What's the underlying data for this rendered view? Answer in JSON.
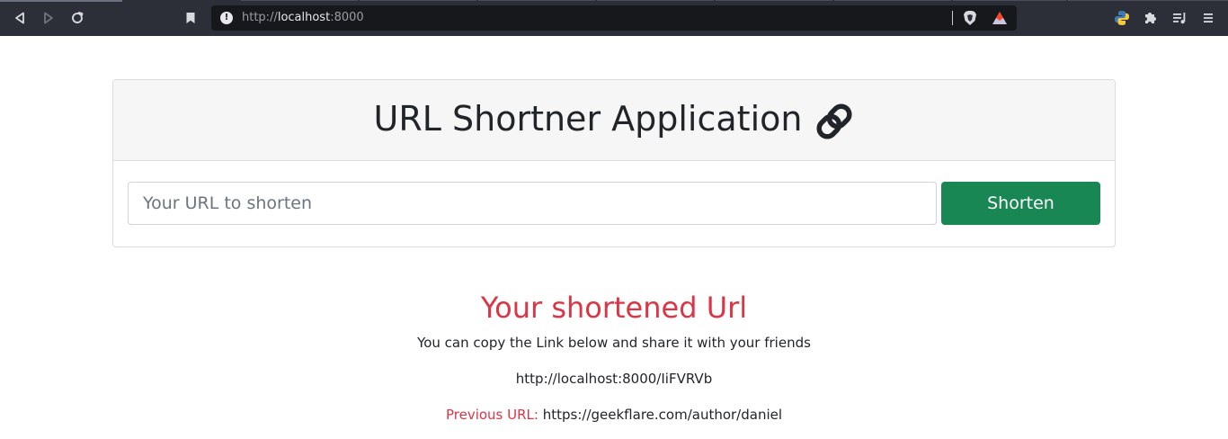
{
  "browser": {
    "address": {
      "scheme": "http://",
      "host": "localhost",
      "port": ":8000"
    }
  },
  "colors": {
    "accent_green": "#198754",
    "accent_red": "#dc3545",
    "chrome_bg": "#2c2f38"
  },
  "icons": {
    "back": "back-icon",
    "forward": "forward-icon",
    "reload": "reload-icon",
    "bookmark": "bookmark-icon",
    "site_info": "info-icon",
    "brave_shield": "brave-shield-icon",
    "brave_rewards": "brave-rewards-icon",
    "python_extension": "python-icon",
    "extensions": "puzzle-icon",
    "media": "playlist-icon",
    "menu": "hamburger-menu-icon",
    "title_link": "link-icon"
  },
  "page": {
    "title": "URL Shortner Application",
    "input_placeholder": "Your URL to shorten",
    "shorten_label": "Shorten",
    "result": {
      "heading": "Your shortened Url",
      "subtext": "You can copy the Link below and share it with your friends",
      "short_url": "http://localhost:8000/IiFVRVb",
      "previous_label": "Previous URL:",
      "previous_url": "https://geekflare.com/author/daniel"
    }
  }
}
